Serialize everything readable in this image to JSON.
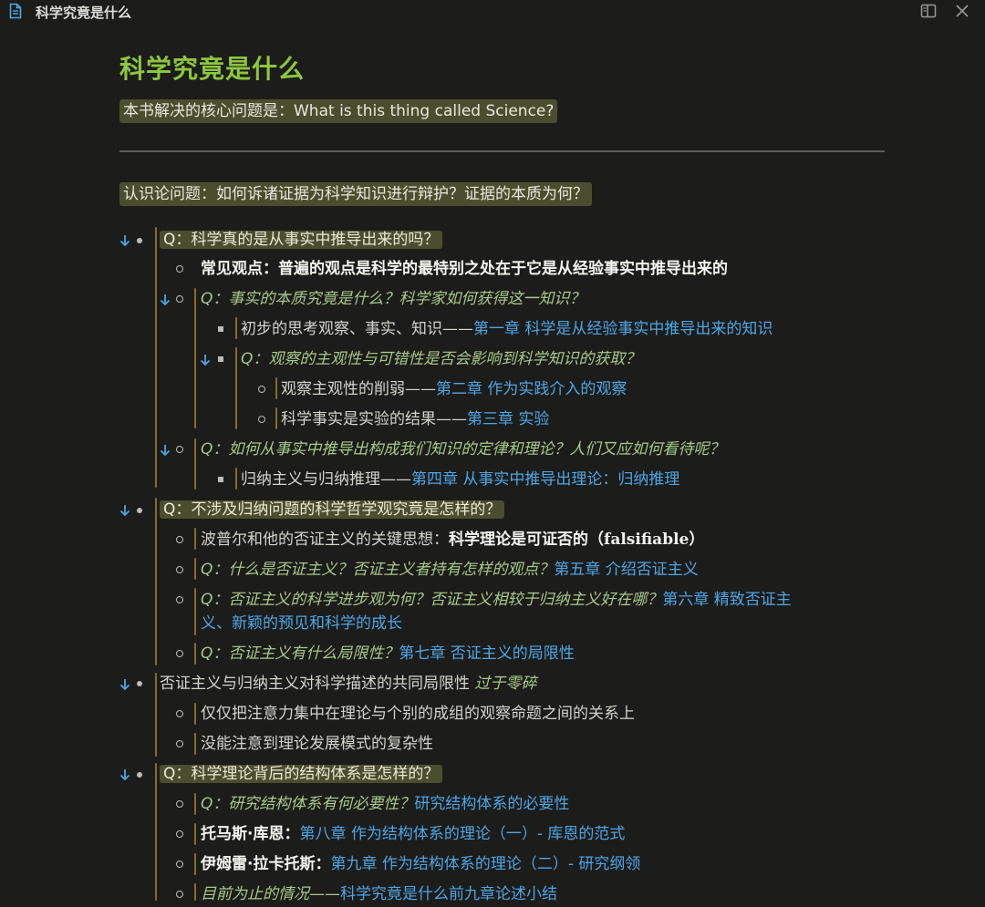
{
  "window": {
    "title": "科学究竟是什么",
    "icons": {
      "doc": "document-icon",
      "layout": "split-view-icon",
      "close": "close-icon"
    }
  },
  "doc": {
    "title": "科学究竟是什么",
    "core_question": "本书解决的核心问题是：What is this thing called Science?",
    "epistemology": "认识论问题：如何诉诸证据为科学知识进行辩护？证据的本质为何？"
  },
  "outline": {
    "q1": {
      "label": "Q：科学真的是从事实中推导出来的吗？",
      "common_view_label": "常见观点：",
      "common_view_text": "普遍的观点是科学的最特别之处在于它是从经验事实中推导出来的",
      "q1a": "Q：事实的本质究竟是什么？科学家如何获得这一知识？",
      "q1a_item_text": "初步的思考观察、事实、知识——",
      "q1a_item_link": "第一章 科学是从经验事实中推导出来的知识",
      "q1a_sub": "Q：观察的主观性与可错性是否会影响到科学知识的获取？",
      "q1a_sub_item1_text": "观察主观性的削弱——",
      "q1a_sub_item1_link": "第二章 作为实践介入的观察",
      "q1a_sub_item2_text": "科学事实是实验的结果——",
      "q1a_sub_item2_link": "第三章 实验",
      "q1b": "Q：如何从事实中推导出构成我们知识的定律和理论？人们又应如何看待呢？",
      "q1b_item_text": "归纳主义与归纳推理——",
      "q1b_item_link": "第四章 从事实中推导出理论：归纳推理"
    },
    "q2": {
      "label": "Q：不涉及归纳问题的科学哲学观究竟是怎样的？",
      "item1_text": "波普尔和他的否证主义的关键思想：",
      "item1_bold": "科学理论是可证否的（",
      "item1_bold_serif": "falsifiable",
      "item1_bold_end": "）",
      "item2_q": "Q：什么是否证主义？否证主义者持有怎样的观点？",
      "item2_link": "第五章 介绍否证主义",
      "item3_q_line1": "Q：否证主义的科学进步观为何？否证主义相较于归纳主义好在哪？",
      "item3_link_line1": "第六章 精致否证主",
      "item3_link_line2": "义、新颖的预见和科学的成长",
      "item4_q": "Q：否证主义有什么局限性？",
      "item4_link": "第七章 否证主义的局限性"
    },
    "limits": {
      "label": "否证主义与归纳主义对科学描述的共同局限性 ",
      "label_italic": "过于零碎",
      "item1": "仅仅把注意力集中在理论与个别的成组的观察命题之间的关系上",
      "item2": "没能注意到理论发展模式的复杂性"
    },
    "q3": {
      "label": "Q：科学理论背后的结构体系是怎样的？",
      "item1_q": "Q：研究结构体系有何必要性？",
      "item1_link": "研究结构体系的必要性",
      "item2_bold": "托马斯·库恩：",
      "item2_link": "第八章 作为结构体系的理论（一）- 库恩的范式",
      "item3_bold": "伊姆雷·拉卡托斯：",
      "item3_link": "第九章 作为结构体系的理论（二）- 研究纲领",
      "item4_q": "目前为止的情况——",
      "item4_link": "科学究竟是什么前九章论述小结"
    }
  },
  "colors": {
    "background": "#1c1c1a",
    "title_green": "#8dc63f",
    "highlight_bg": "#4a4e2e",
    "link_blue": "#4ea6e6",
    "italic_green": "#a7c98a",
    "guide_bar": "#8a6a2c",
    "collapse_arrow": "#4ea6e6"
  }
}
